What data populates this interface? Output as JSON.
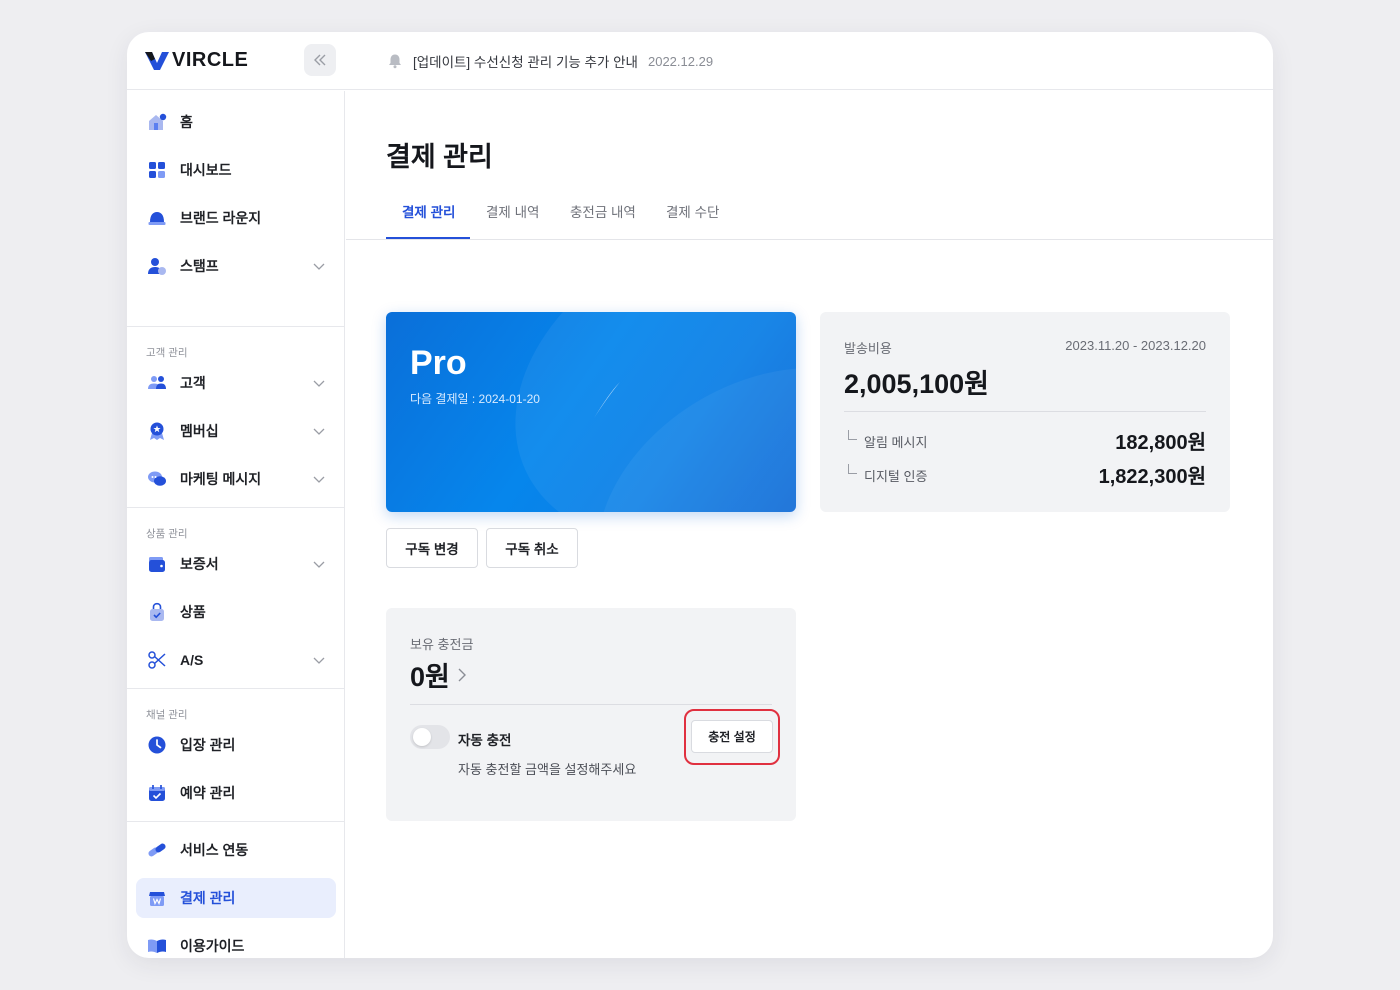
{
  "brand": {
    "name": "VIRCLE",
    "accent": "#2450d9"
  },
  "notice": {
    "text": "[업데이트] 수선신청 관리 기능 추가 안내",
    "date": "2022.12.29"
  },
  "sidebar": {
    "items": [
      {
        "label": "홈",
        "icon": "home-icon"
      },
      {
        "label": "대시보드",
        "icon": "dashboard-icon"
      },
      {
        "label": "브랜드 라운지",
        "icon": "lounge-icon"
      },
      {
        "label": "스탬프",
        "icon": "stamp-icon",
        "expandable": true
      }
    ],
    "sections": [
      {
        "title": "고객 관리",
        "items": [
          {
            "label": "고객",
            "icon": "customer-icon",
            "expandable": true
          },
          {
            "label": "멤버십",
            "icon": "membership-icon",
            "expandable": true
          },
          {
            "label": "마케팅 메시지",
            "icon": "chat-icon",
            "expandable": true
          }
        ]
      },
      {
        "title": "상품 관리",
        "items": [
          {
            "label": "보증서",
            "icon": "wallet-icon",
            "expandable": true
          },
          {
            "label": "상품",
            "icon": "bag-icon"
          },
          {
            "label": "A/S",
            "icon": "scissors-icon",
            "expandable": true
          }
        ]
      },
      {
        "title": "채널 관리",
        "items": [
          {
            "label": "입장 관리",
            "icon": "clock-icon"
          },
          {
            "label": "예약 관리",
            "icon": "calendar-icon"
          }
        ]
      }
    ],
    "bottom_items": [
      {
        "label": "서비스 연동",
        "icon": "link-icon"
      },
      {
        "label": "결제 관리",
        "icon": "payment-icon",
        "active": true
      },
      {
        "label": "이용가이드",
        "icon": "book-icon"
      },
      {
        "label": "",
        "icon": "more-icon"
      }
    ]
  },
  "page": {
    "title": "결제 관리",
    "tabs": [
      "결제 관리",
      "결제 내역",
      "충전금 내역",
      "결제 수단"
    ],
    "active_tab": 0
  },
  "plan": {
    "name": "Pro",
    "next_payment": "다음 결제일 : 2024-01-20",
    "change_label": "구독 변경",
    "cancel_label": "구독 취소"
  },
  "fees": {
    "label": "발송비용",
    "period": "2023.11.20 - 2023.12.20",
    "total": "2,005,100원",
    "rows": [
      {
        "name": "알림 메시지",
        "amount": "182,800원"
      },
      {
        "name": "디지털 인증",
        "amount": "1,822,300원"
      }
    ]
  },
  "charge": {
    "label": "보유 충전금",
    "amount": "0원",
    "auto_label": "자동 충전",
    "auto_desc": "자동 충전할 금액을 설정해주세요",
    "auto_enabled": false,
    "setting_label": "충전 설정"
  }
}
